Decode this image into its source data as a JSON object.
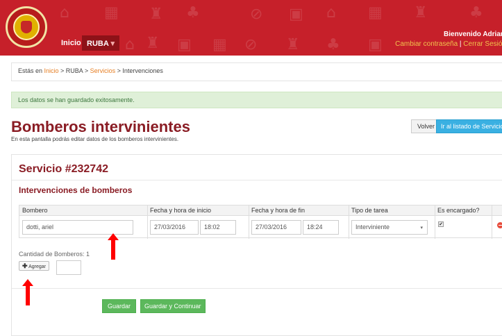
{
  "header": {
    "nav": {
      "inicio": "Inicio",
      "ruba": "RUBA",
      "ruba_caret": "▾"
    },
    "welcome": "Bienvenido Adrian",
    "change_password": "Cambiar contraseña",
    "separator": " | ",
    "logout": "Cerrar Sesión",
    "brand_color": "#c6202a",
    "logo_icon": "fire-department-emblem-icon",
    "watermark_icons": [
      "house-fire-icon",
      "building-icon",
      "hydrant-icon",
      "tree-icon",
      "no-fire-icon",
      "box-icon",
      "fire-extinguisher-icon"
    ]
  },
  "breadcrumb": {
    "prefix": "Estás en ",
    "inicio": "Inicio",
    "sep1": " > RUBA > ",
    "servicios": "Servicios",
    "sep2": " > ",
    "current": "Intervenciones"
  },
  "alert": {
    "message": "Los datos se han guardado exitosamente.",
    "color": "#dff0d8"
  },
  "page": {
    "title": "Bomberos intervinientes",
    "subtitle": "En esta pantalla podrás editar datos de los bomberos intervinientes.",
    "volver": "Volver",
    "ir_listado": "Ir al listado de Servicios"
  },
  "servicio": {
    "title": "Servicio #232742",
    "section_title": "Intervenciones de bomberos",
    "columns": [
      "Bombero",
      "Fecha y hora de inicio",
      "Fecha y hora de fin",
      "Tipo de tarea",
      "Es encargado?"
    ],
    "rows": [
      {
        "bombero": "dotti, ariel",
        "inicio_fecha": "27/03/2016",
        "inicio_hora": "18:02",
        "fin_fecha": "27/03/2016",
        "fin_hora": "18:24",
        "tipo_tarea": "Interviniente",
        "es_encargado": "✔"
      }
    ],
    "cantidad": "Cantidad de Bomberos: 1",
    "agregar_plus": "✚",
    "agregar": "Agregar"
  },
  "actions": {
    "guardar": "Guardar",
    "guardar_continuar": "Guardar y Continuar",
    "accent": "#5cb85c"
  }
}
